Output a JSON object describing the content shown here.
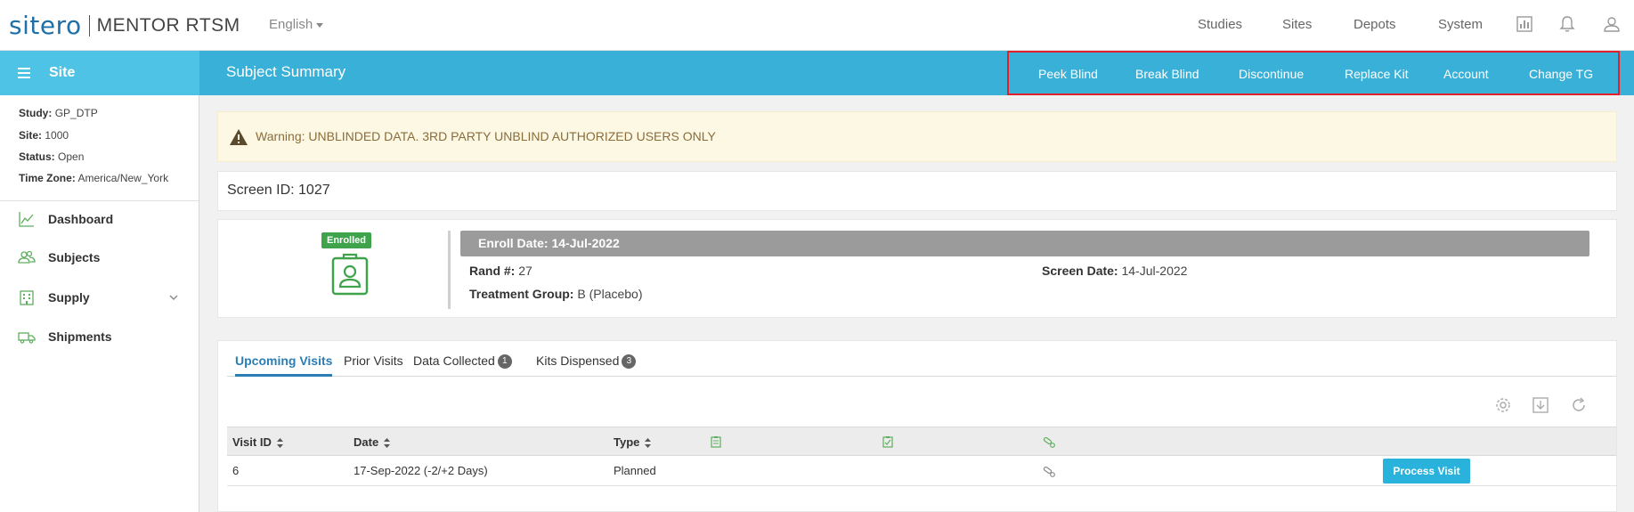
{
  "brand": {
    "logo_name": "sitero",
    "product": "MENTOR RTSM"
  },
  "language": {
    "selected": "English"
  },
  "top_nav": [
    "Studies",
    "Sites",
    "Depots",
    "System"
  ],
  "top_icons": [
    "report-icon",
    "bell-icon",
    "user-icon"
  ],
  "header": {
    "section": "Site",
    "page_title": "Subject Summary",
    "actions": [
      "Peek Blind",
      "Break Blind",
      "Discontinue",
      "Replace Kit",
      "Account",
      "Change TG"
    ],
    "highlight_color": "#e0202a"
  },
  "sidebar": {
    "info": [
      {
        "label": "Study:",
        "value": "GP_DTP"
      },
      {
        "label": "Site:",
        "value": "1000"
      },
      {
        "label": "Status:",
        "value": "Open"
      },
      {
        "label": "Time Zone:",
        "value": "America/New_York"
      }
    ],
    "items": [
      {
        "label": "Dashboard",
        "icon": "chart-line-icon"
      },
      {
        "label": "Subjects",
        "icon": "users-icon"
      },
      {
        "label": "Supply",
        "icon": "building-icon"
      },
      {
        "label": "Shipments",
        "icon": "truck-icon"
      }
    ]
  },
  "warning": {
    "text": "Warning: UNBLINDED DATA. 3RD PARTY UNBLIND AUTHORIZED USERS ONLY"
  },
  "subject": {
    "screen_id": "Screen ID: 1027",
    "badge": "Enrolled",
    "enroll_date": "Enroll Date: 14-Jul-2022",
    "rand_label": "Rand #:",
    "rand_value": "27",
    "treatment_label": "Treatment Group:",
    "treatment_value": "B (Placebo)",
    "screen_date_label": "Screen Date:",
    "screen_date_value": "14-Jul-2022"
  },
  "tabs": [
    {
      "label": "Upcoming Visits",
      "count": ""
    },
    {
      "label": "Prior Visits",
      "count": ""
    },
    {
      "label": "Data Collected",
      "count": "1"
    },
    {
      "label": "Kits Dispensed",
      "count": "3"
    }
  ],
  "table": {
    "columns": [
      "Visit ID",
      "Date",
      "Type"
    ],
    "rows": [
      {
        "visit_id": "6",
        "date": "17-Sep-2022 (-2/+2 Days)",
        "type": "Planned",
        "action": "Process Visit"
      }
    ]
  },
  "colors": {
    "accent": "#38b0d8",
    "accent_light": "#4ec3e6",
    "success": "#3ea34a",
    "link": "#2a7db5"
  }
}
